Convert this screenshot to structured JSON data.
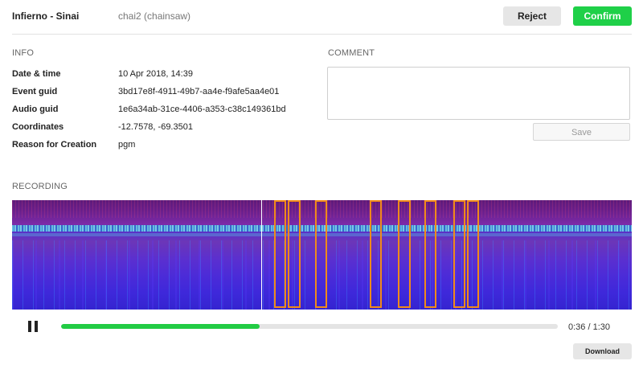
{
  "header": {
    "site_name": "Infierno - Sinai",
    "event_label": "chai2 (chainsaw)",
    "reject_label": "Reject",
    "confirm_label": "Confirm"
  },
  "info": {
    "title": "INFO",
    "rows": [
      {
        "key": "Date & time",
        "value": "10 Apr 2018, 14:39"
      },
      {
        "key": "Event guid",
        "value": "3bd17e8f-4911-49b7-aa4e-f9afe5aa4e01"
      },
      {
        "key": "Audio guid",
        "value": "1e6a34ab-31ce-4406-a353-c38c149361bd"
      },
      {
        "key": "Coordinates",
        "value": "-12.7578, -69.3501"
      },
      {
        "key": "Reason for Creation",
        "value": "pgm"
      }
    ]
  },
  "comment": {
    "title": "COMMENT",
    "value": "",
    "save_label": "Save"
  },
  "recording": {
    "title": "RECORDING",
    "playback_state": "playing",
    "progress": 0.4,
    "time_label": "0:36 / 1:30",
    "download_label": "Download"
  },
  "colors": {
    "confirm": "#1fd048",
    "progress": "#22cc44",
    "detection_box": "#f08a1a"
  }
}
